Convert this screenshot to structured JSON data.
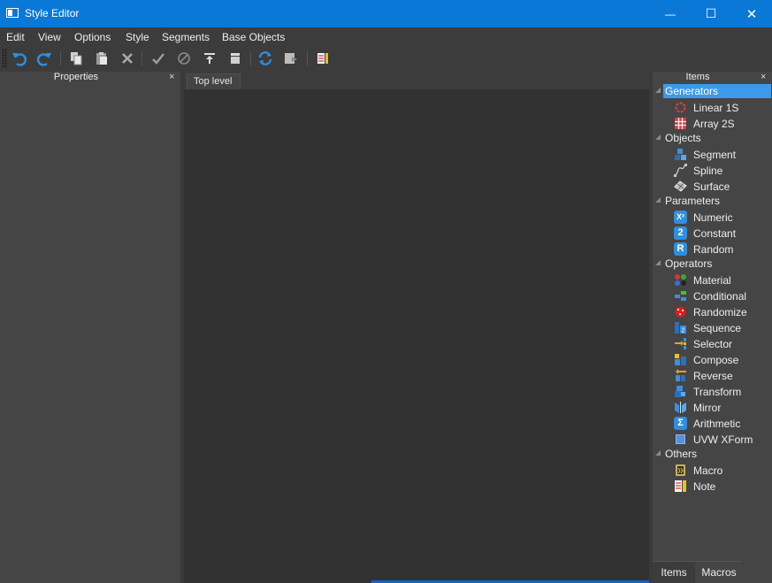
{
  "window": {
    "title": "Style Editor",
    "minimize_glyph": "—",
    "maximize_glyph": "☐",
    "close_glyph": "✕"
  },
  "menu": [
    "Edit",
    "View",
    "Options",
    "Style",
    "Segments",
    "Base Objects"
  ],
  "toolbar": {
    "icons": [
      "undo-icon",
      "redo-icon",
      "copy-icon",
      "paste-icon",
      "delete-icon",
      "check-icon",
      "disable-icon",
      "push-top-icon",
      "collapse-icon",
      "refresh-icon",
      "export-icon",
      "note-icon"
    ]
  },
  "properties_panel": {
    "title": "Properties",
    "close": "×"
  },
  "center": {
    "tab": "Top level"
  },
  "items_panel": {
    "title": "Items",
    "close": "×",
    "groups": [
      {
        "label": "Generators",
        "items": [
          {
            "label": "Linear 1S",
            "icon": "linear-icon"
          },
          {
            "label": "Array 2S",
            "icon": "array-icon"
          }
        ]
      },
      {
        "label": "Objects",
        "items": [
          {
            "label": "Segment",
            "icon": "segment-icon"
          },
          {
            "label": "Spline",
            "icon": "spline-icon"
          },
          {
            "label": "Surface",
            "icon": "surface-icon"
          }
        ]
      },
      {
        "label": "Parameters",
        "items": [
          {
            "label": "Numeric",
            "icon": "numeric-icon"
          },
          {
            "label": "Constant",
            "icon": "constant-icon"
          },
          {
            "label": "Random",
            "icon": "random-icon"
          }
        ]
      },
      {
        "label": "Operators",
        "items": [
          {
            "label": "Material",
            "icon": "material-icon"
          },
          {
            "label": "Conditional",
            "icon": "conditional-icon"
          },
          {
            "label": "Randomize",
            "icon": "randomize-icon"
          },
          {
            "label": "Sequence",
            "icon": "sequence-icon"
          },
          {
            "label": "Selector",
            "icon": "selector-icon"
          },
          {
            "label": "Compose",
            "icon": "compose-icon"
          },
          {
            "label": "Reverse",
            "icon": "reverse-icon"
          },
          {
            "label": "Transform",
            "icon": "transform-icon"
          },
          {
            "label": "Mirror",
            "icon": "mirror-icon"
          },
          {
            "label": "Arithmetic",
            "icon": "arithmetic-icon"
          },
          {
            "label": "UVW XForm",
            "icon": "uvw-xform-icon"
          }
        ]
      },
      {
        "label": "Others",
        "items": [
          {
            "label": "Macro",
            "icon": "macro-icon"
          },
          {
            "label": "Note",
            "icon": "note-icon"
          }
        ]
      }
    ],
    "selected_group": "Generators",
    "numeric_icon_text": "X²",
    "constant_icon_text": "2",
    "random_icon_text": "R",
    "arithmetic_icon_text": "Σ",
    "sequence_icon_text": "2"
  },
  "bottom_tabs": [
    "Items",
    "Macros"
  ]
}
